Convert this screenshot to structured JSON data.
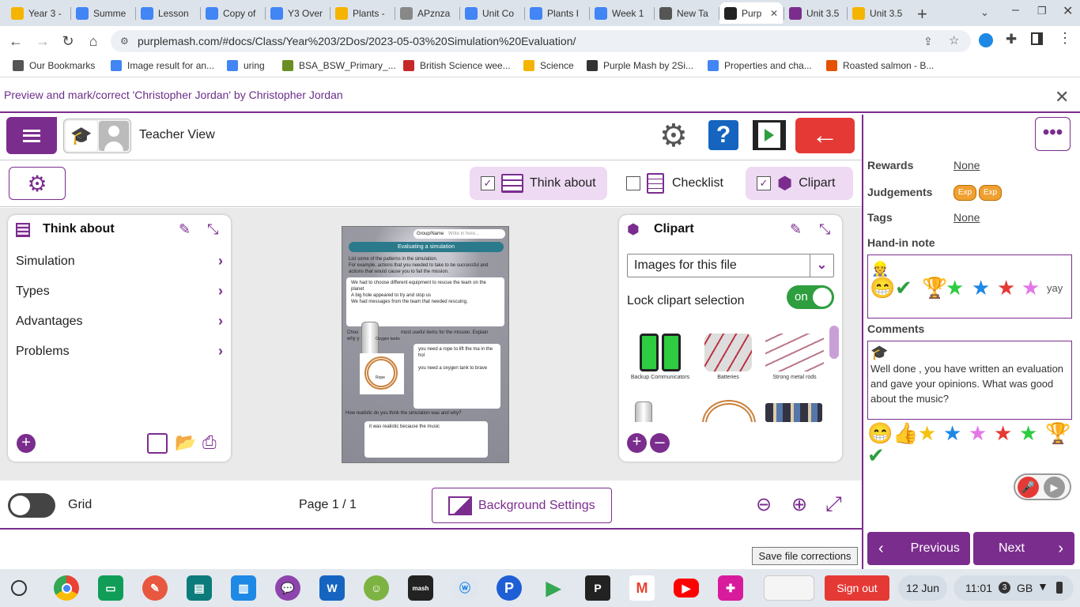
{
  "browser": {
    "tabs": [
      {
        "label": "Year 3 -",
        "color": "#f4b400"
      },
      {
        "label": "Summe",
        "color": "#4285f4"
      },
      {
        "label": "Lesson",
        "color": "#4285f4"
      },
      {
        "label": "Copy of",
        "color": "#4285f4"
      },
      {
        "label": "Y3 Over",
        "color": "#4285f4"
      },
      {
        "label": "Plants -",
        "color": "#f4b400"
      },
      {
        "label": "APznza",
        "color": "#888888"
      },
      {
        "label": "Unit Co",
        "color": "#4285f4"
      },
      {
        "label": "Plants I",
        "color": "#4285f4"
      },
      {
        "label": "Week 1",
        "color": "#4285f4"
      },
      {
        "label": "New Ta",
        "color": "#555555"
      },
      {
        "label": "Purp",
        "color": "#222222",
        "active": true
      },
      {
        "label": "Unit 3.5",
        "color": "#7b2d8e"
      },
      {
        "label": "Unit 3.5",
        "color": "#f4b400"
      }
    ],
    "url": "purplemash.com/#docs/Class/Year%203/2Dos/2023-05-03%20Simulation%20Evaluation/",
    "bookmarks": [
      {
        "label": "Our Bookmarks",
        "color": "#555555"
      },
      {
        "label": "Image result for an...",
        "color": "#4285f4"
      },
      {
        "label": "uring",
        "color": "#4285f4"
      },
      {
        "label": "BSA_BSW_Primary_...",
        "color": "#6b8e23"
      },
      {
        "label": "British Science wee...",
        "color": "#c62828"
      },
      {
        "label": "Science",
        "color": "#f4b400"
      },
      {
        "label": "Purple Mash by 2Si...",
        "color": "#333333"
      },
      {
        "label": "Properties and cha...",
        "color": "#4285f4"
      },
      {
        "label": "Roasted salmon - B...",
        "color": "#e65100"
      }
    ]
  },
  "preview": {
    "title": "Preview and mark/correct 'Christopher Jordan' by Christopher Jordan"
  },
  "header": {
    "view_label": "Teacher View"
  },
  "panel_toggles": {
    "think_about": "Think about",
    "checklist": "Checklist",
    "clipart": "Clipart"
  },
  "think_about": {
    "title": "Think about",
    "items": [
      "Simulation",
      "Types",
      "Advantages",
      "Problems"
    ]
  },
  "document": {
    "group_name_label": "Group/Name",
    "group_name_placeholder": "Write in here...",
    "heading": "Evaluating a simulation",
    "prompt1": "List some of the patterns in the simulation.",
    "prompt1b": "For example, actions that you needed to take to be successful and actions that would cause you to fail the mission.",
    "answer1": [
      "We had to choose different equipment to rescue the team on the planet",
      "A big hole appeared to try and stop us",
      "We had messages from the team that needed rescuing."
    ],
    "prompt2_start": "Choo",
    "prompt2_end": "most useful items for the mission. Explain",
    "prompt2_why": "why y",
    "img_oxygen": "Oxygen tanks",
    "img_rope": "Rope",
    "answer2a": "you need a rope to lift the ma in the hol",
    "answer2b": "you need a oxygen tank to brave",
    "prompt3": "How realistic do you think the simulation was and why?",
    "answer3": "it was realistic because the music"
  },
  "clipart": {
    "title": "Clipart",
    "dropdown_value": "Images for this file",
    "lock_label": "Lock clipart selection",
    "lock_state": "on",
    "items": [
      {
        "label": "Backup Communicators"
      },
      {
        "label": "Batteries"
      },
      {
        "label": "Strong metal rods"
      },
      {
        "label": ""
      },
      {
        "label": ""
      },
      {
        "label": ""
      }
    ]
  },
  "bottom": {
    "grid_label": "Grid",
    "page_label": "Page 1 / 1",
    "bg_settings": "Background Settings",
    "save_corrections": "Save file corrections"
  },
  "sidebar": {
    "rewards_label": "Rewards",
    "rewards_value": "None",
    "judgements_label": "Judgements",
    "judgement_badges": [
      "Exp",
      "Exp"
    ],
    "tags_label": "Tags",
    "tags_value": "None",
    "handin_label": "Hand-in note",
    "handin_text": "yay",
    "comments_label": "Comments",
    "comment_text": "Well done , you have written an evaluation and gave your opinions. What was good about the music?",
    "prev_label": "Previous",
    "next_label": "Next"
  },
  "shelf": {
    "signout": "Sign out",
    "date": "12 Jun",
    "time": "11:01",
    "notif_count": "3",
    "locale": "GB"
  },
  "colors": {
    "accent": "#7b2d8e",
    "danger": "#e53935",
    "help": "#1565c0"
  }
}
